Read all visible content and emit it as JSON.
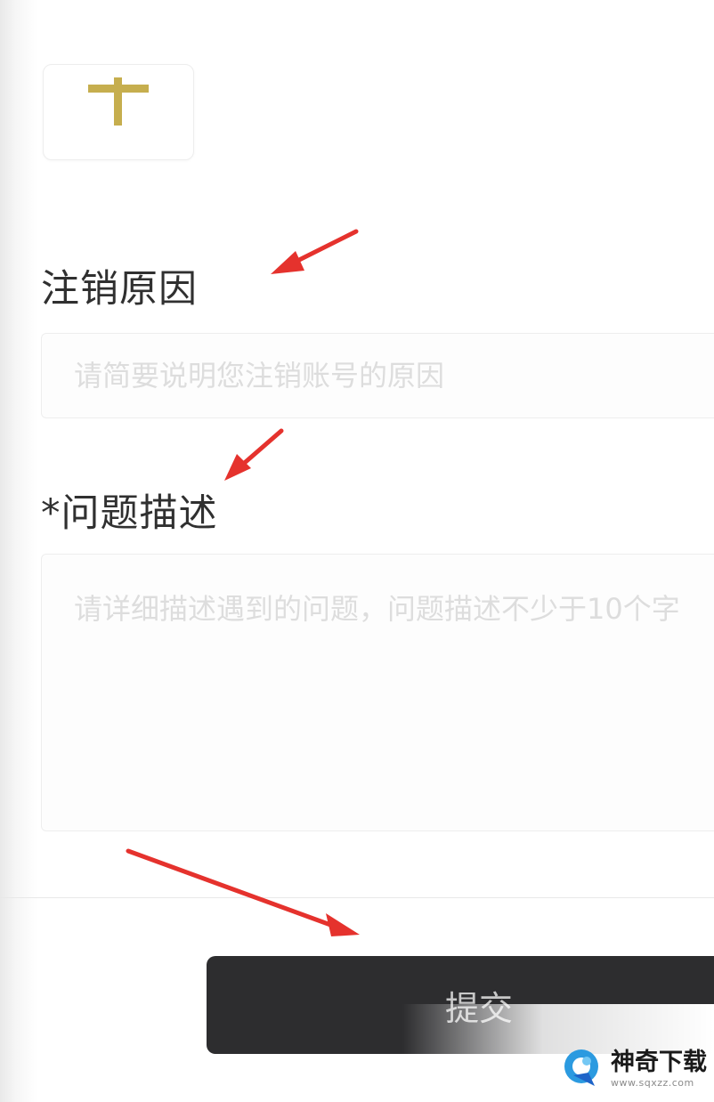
{
  "upload": {
    "icon": "plus-icon",
    "icon_color": "#C6AE4E"
  },
  "reason": {
    "label": "注销原因",
    "placeholder": "请简要说明您注销账号的原因"
  },
  "description": {
    "label": "*问题描述",
    "placeholder": "请详细描述遇到的问题，问题描述不少于10个字"
  },
  "actions": {
    "submit_label": "提交"
  },
  "watermark": {
    "title": "神奇下载",
    "url": "www.sqxzz.com"
  },
  "colors": {
    "arrow": "#E5322D",
    "button": "#2D2D2F"
  }
}
